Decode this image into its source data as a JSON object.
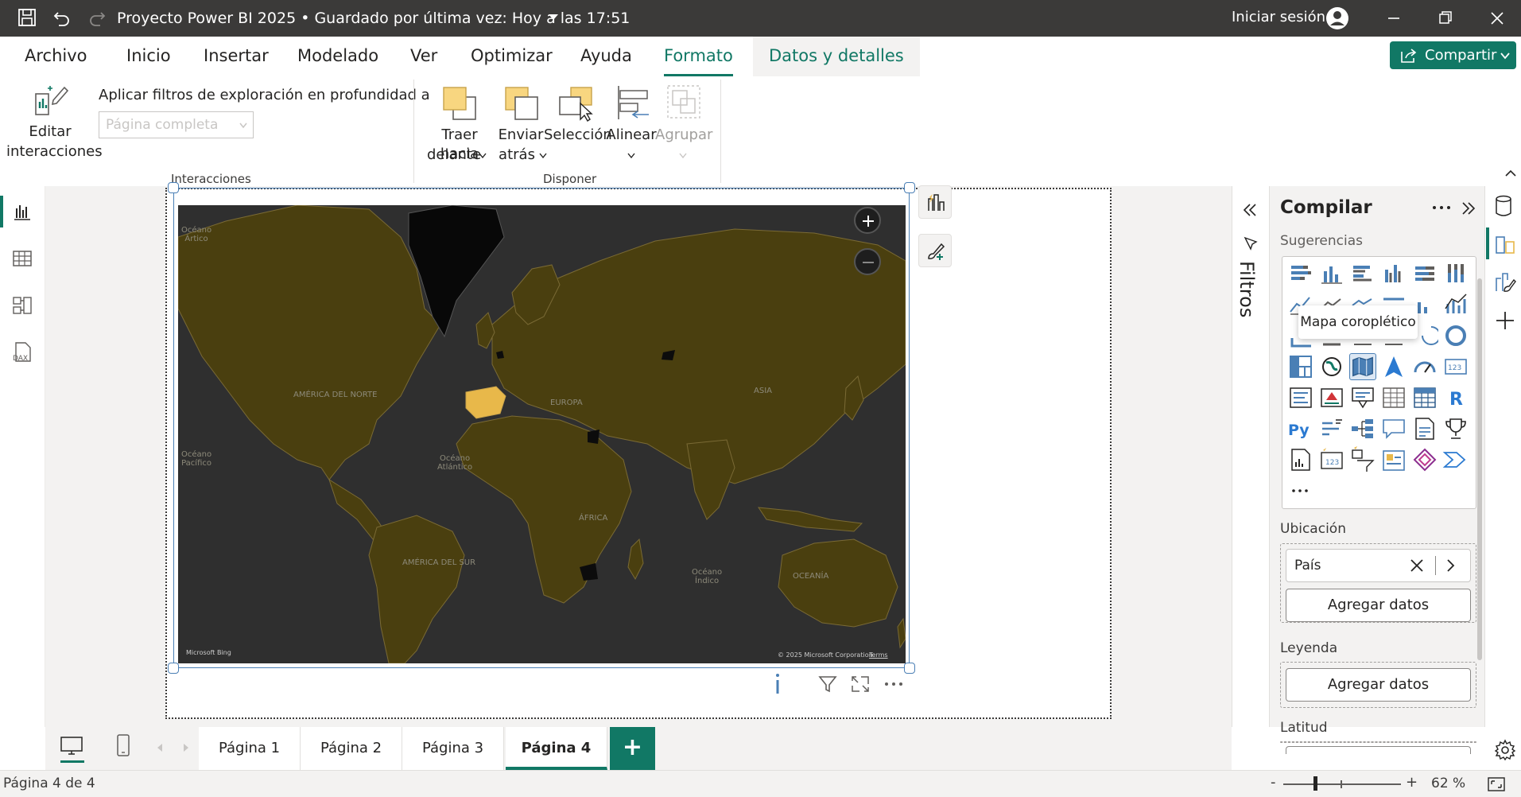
{
  "window": {
    "title": "Proyecto Power BI 2025 • Guardado por última vez: Hoy a las 17:51",
    "sign_in": "Iniciar sesión"
  },
  "menu": {
    "items": [
      "Archivo",
      "Inicio",
      "Insertar",
      "Modelado",
      "Ver",
      "Optimizar",
      "Ayuda",
      "Formato",
      "Datos y detalles"
    ],
    "active": "Formato",
    "share_label": "Compartir"
  },
  "ribbon": {
    "edit_interactions": [
      "Editar",
      "interacciones"
    ],
    "drill_label": "Aplicar filtros de exploración en profundidad a",
    "drill_placeholder": "Página completa",
    "bring_forward": [
      "Traer hacia",
      "delante"
    ],
    "send_back": [
      "Enviar",
      "atrás"
    ],
    "selection": "Selección",
    "align": "Alinear",
    "group": "Agrupar",
    "group_interactions": "Interacciones",
    "group_arrange": "Disponer"
  },
  "map": {
    "labels": {
      "arctic": [
        "Océano",
        "Ártico"
      ],
      "north_america": "AMÉRICA DEL NORTE",
      "pacific": [
        "Océano",
        "Pacífico"
      ],
      "atlantic": [
        "Océano",
        "Atlántico"
      ],
      "europe": "EUROPA",
      "asia": "ASIA",
      "africa": "ÁFRICA",
      "south_america": "AMÉRICA DEL SUR",
      "indian": [
        "Océano",
        "Índico"
      ],
      "oceania": "OCEANÍA"
    },
    "attribution": "Microsoft Bing",
    "copyright": "© 2025 Microsoft Corporation",
    "terms": "Terms",
    "highlight_color": "#e8b84a",
    "base_color": "#4a3f0f"
  },
  "pane": {
    "title": "Compilar",
    "suggestions": "Sugerencias",
    "tooltip": "Mapa coroplético",
    "location_label": "Ubicación",
    "location_field": "País",
    "add_data": "Agregar datos",
    "legend_label": "Leyenda",
    "latitude_label": "Latitud"
  },
  "filters": {
    "label": "Filtros"
  },
  "tabs": {
    "items": [
      "Página 1",
      "Página 2",
      "Página 3",
      "Página 4"
    ],
    "active": "Página 4",
    "add": "+"
  },
  "status": {
    "page_info": "Página 4 de 4",
    "zoom": "62 %",
    "zoom_minus": "-",
    "zoom_plus": "+"
  },
  "colors": {
    "accent": "#117865",
    "titlebar": "#3b3a39",
    "map_bg": "#2f2f2f"
  }
}
